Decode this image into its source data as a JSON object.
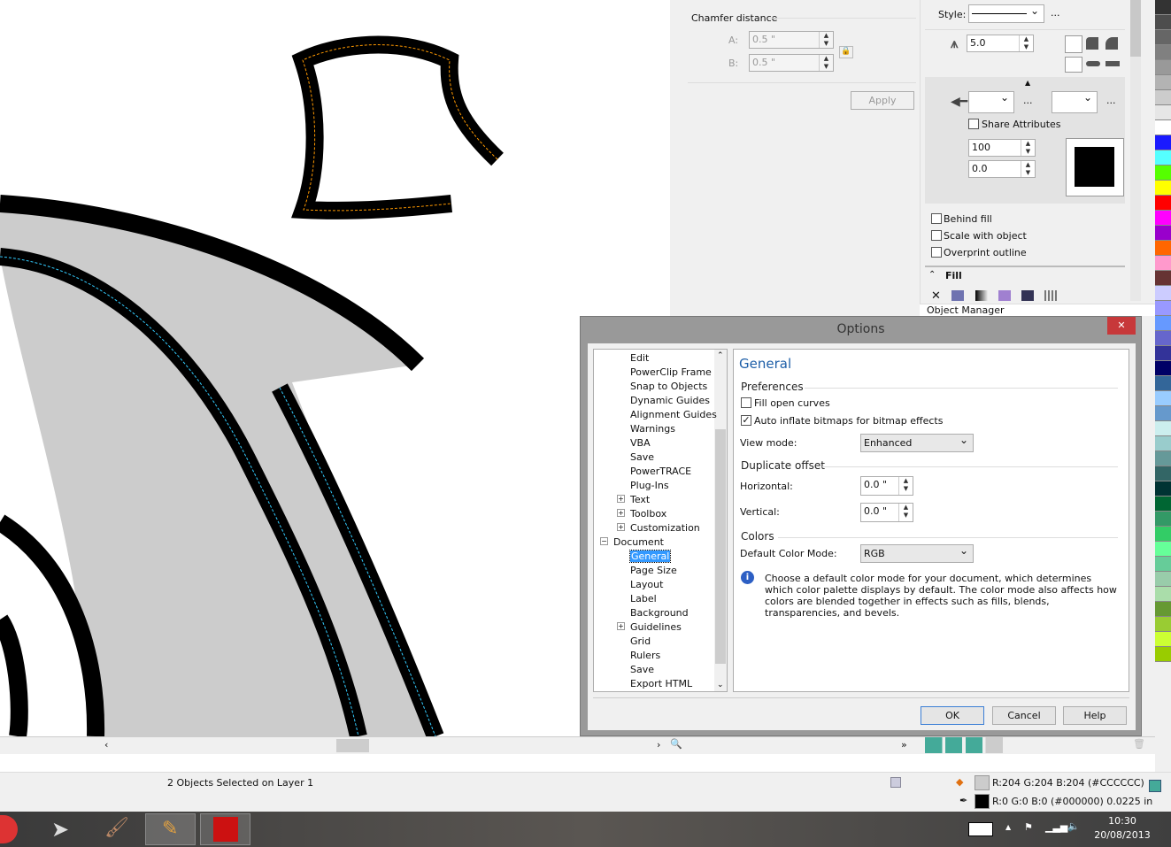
{
  "dock": {
    "chamfer_label": "Chamfer distance",
    "a_label": "A:",
    "a_value": "0.5 \"",
    "b_label": "B:",
    "b_value": "0.5 \"",
    "apply": "Apply",
    "style_label": "Style:",
    "ellipsis": "...",
    "width_value": "5.0",
    "share_attributes": "Share Attributes",
    "stretch_value": "100",
    "angle_value": "0.0",
    "behind_fill": "Behind fill",
    "scale_with_object": "Scale with object",
    "overprint_outline": "Overprint outline",
    "fill_header": "Fill",
    "object_manager": "Object Manager"
  },
  "dialog": {
    "title": "Options",
    "close": "✕",
    "tree": [
      {
        "label": "Edit",
        "level": 2
      },
      {
        "label": "PowerClip Frame",
        "level": 2
      },
      {
        "label": "Snap to Objects",
        "level": 2
      },
      {
        "label": "Dynamic Guides",
        "level": 2
      },
      {
        "label": "Alignment Guides",
        "level": 2
      },
      {
        "label": "Warnings",
        "level": 2
      },
      {
        "label": "VBA",
        "level": 2
      },
      {
        "label": "Save",
        "level": 2
      },
      {
        "label": "PowerTRACE",
        "level": 2
      },
      {
        "label": "Plug-Ins",
        "level": 2
      },
      {
        "label": "Text",
        "level": 2,
        "expander": "+"
      },
      {
        "label": "Toolbox",
        "level": 2,
        "expander": "+"
      },
      {
        "label": "Customization",
        "level": 2,
        "expander": "+"
      },
      {
        "label": "Document",
        "level": 1,
        "expander": "−"
      },
      {
        "label": "General",
        "level": 2,
        "selected": true
      },
      {
        "label": "Page Size",
        "level": 2
      },
      {
        "label": "Layout",
        "level": 2
      },
      {
        "label": "Label",
        "level": 2
      },
      {
        "label": "Background",
        "level": 2
      },
      {
        "label": "Guidelines",
        "level": 2,
        "expander": "+"
      },
      {
        "label": "Grid",
        "level": 2
      },
      {
        "label": "Rulers",
        "level": 2
      },
      {
        "label": "Save",
        "level": 2
      },
      {
        "label": "Export HTML",
        "level": 2
      }
    ],
    "page_title": "General",
    "preferences": "Preferences",
    "fill_open_curves": "Fill open curves",
    "fill_open_curves_checked": false,
    "auto_inflate": "Auto inflate bitmaps for bitmap effects",
    "auto_inflate_checked": true,
    "view_mode_label": "View mode:",
    "view_mode_value": "Enhanced",
    "duplicate_offset": "Duplicate offset",
    "horizontal_label": "Horizontal:",
    "horizontal_value": "0.0 \"",
    "vertical_label": "Vertical:",
    "vertical_value": "0.0 \"",
    "colors": "Colors",
    "color_mode_label": "Default Color Mode:",
    "color_mode_value": "RGB",
    "info_text": "Choose a default color mode for your document, which determines which color palette displays by default. The color mode also affects how colors are blended together in effects such as fills, blends, transparencies, and bevels.",
    "ok": "OK",
    "cancel": "Cancel",
    "help": "Help"
  },
  "status": {
    "selection": "2 Objects Selected on Layer 1",
    "fill_info": "R:204 G:204 B:204 (#CCCCCC)",
    "fill_color": "#CCCCCC",
    "outline_info": "R:0 G:0 B:0 (#000000)  0.0225 in",
    "outline_color": "#000000"
  },
  "taskbar": {
    "time": "10:30",
    "date": "20/08/2013"
  },
  "palette": [
    "#333333",
    "#4d4d4d",
    "#666666",
    "#808080",
    "#999999",
    "#b3b3b3",
    "#cccccc",
    "#e6e6e6",
    "#ffffff",
    "#1a1aff",
    "#55ffff",
    "#55ff00",
    "#ffff00",
    "#ff0000",
    "#ff00ff",
    "#9900cc",
    "#ff6600",
    "#ff99cc",
    "#663333",
    "#ccccff",
    "#9999ff",
    "#6699ff",
    "#6666cc",
    "#333399",
    "#000066",
    "#336699",
    "#99ccff",
    "#6699cc",
    "#cceeee",
    "#99cccc",
    "#669999",
    "#336666",
    "#003333",
    "#006633",
    "#339966",
    "#33cc66",
    "#66ff99",
    "#66cc99",
    "#99ccaa",
    "#aaddaa",
    "#669933",
    "#99cc33",
    "#ccff33",
    "#99cc00"
  ]
}
